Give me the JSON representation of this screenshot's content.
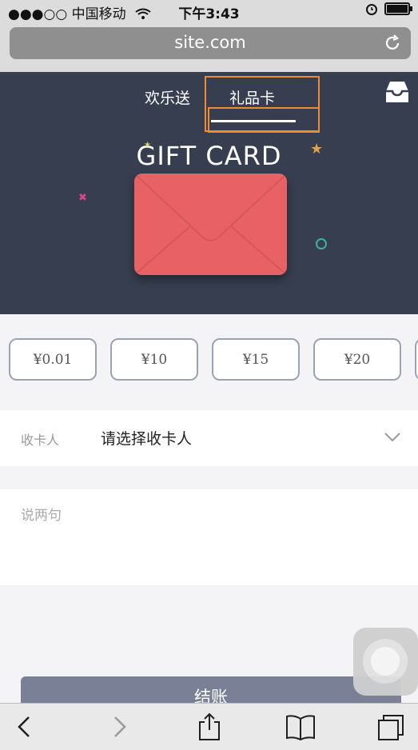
{
  "status_bar": {
    "carrier": "●●●○○ 中国移动",
    "time": "下午3:43"
  },
  "browser": {
    "url": "site.com"
  },
  "header": {
    "tabs": [
      "欢乐送",
      "礼品卡"
    ],
    "active_tab": "礼品卡",
    "title": "GIFT CARD"
  },
  "amounts": [
    "¥0.01",
    "¥10",
    "¥15",
    "¥20"
  ],
  "recipient": {
    "label": "收卡人",
    "placeholder": "请选择收卡人"
  },
  "message": {
    "placeholder": "说两句"
  },
  "checkout": {
    "label": "结账"
  },
  "colors": {
    "hero_bg": "#363e4f",
    "envelope": "#e86265",
    "highlight": "#f08b34",
    "checkout": "#7a8196"
  },
  "icons": [
    "wifi-icon",
    "alarm-icon",
    "battery-icon",
    "reload-icon",
    "inbox-icon",
    "chevron-down-icon",
    "back-icon",
    "forward-icon",
    "share-icon",
    "bookmarks-icon",
    "tabs-icon"
  ]
}
